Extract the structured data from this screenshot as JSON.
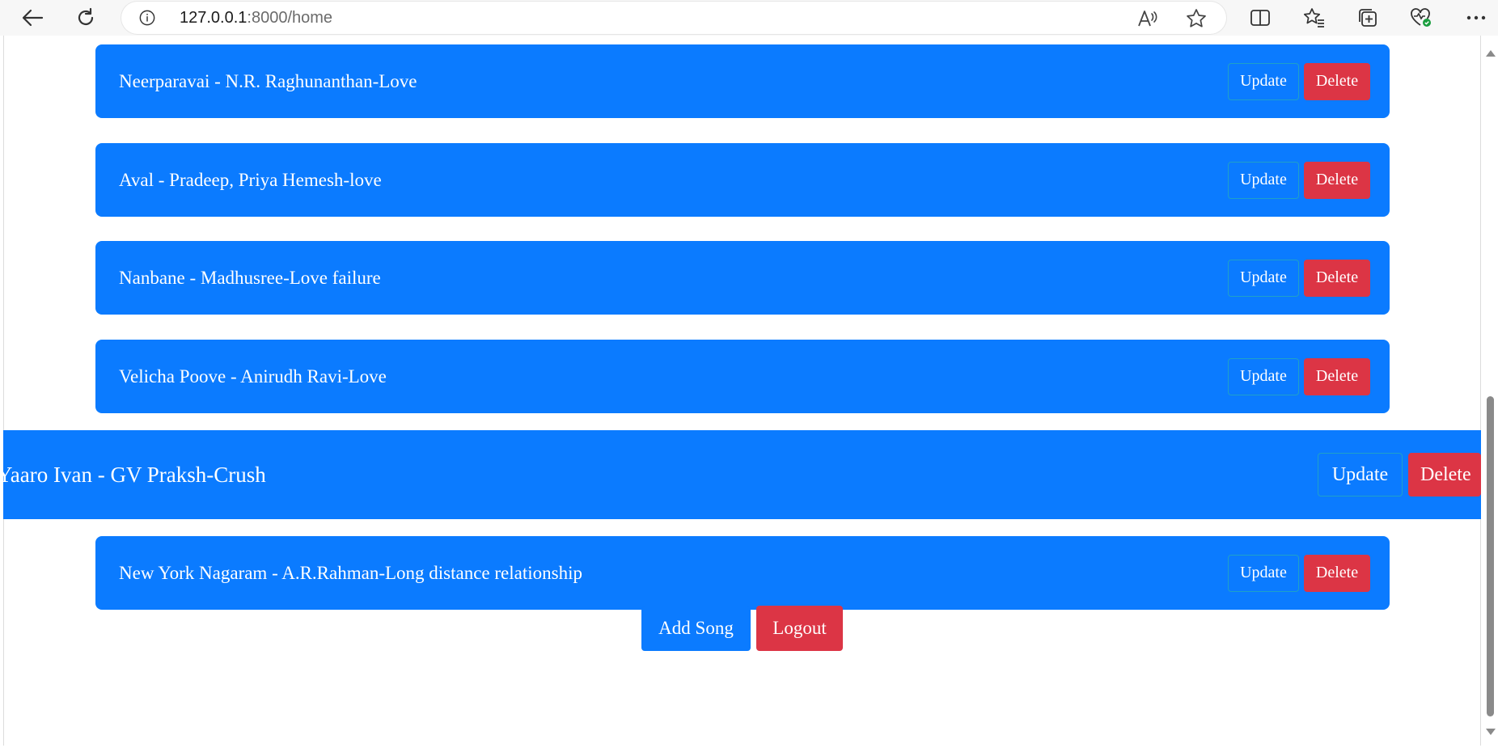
{
  "browser": {
    "url_host": "127.0.0.1",
    "url_path": ":8000/home",
    "icons": [
      "back-icon",
      "refresh-icon",
      "site-info-icon",
      "read-aloud-icon",
      "favorite-star-icon",
      "split-screen-icon",
      "favorites-icon",
      "collections-icon",
      "browser-essentials-icon",
      "more-icon"
    ]
  },
  "songs": [
    {
      "title": "Neerparavai - N.R. Raghunanthan-Love",
      "update_label": "Update",
      "delete_label": "Delete"
    },
    {
      "title": "Aval - Pradeep, Priya Hemesh-love",
      "update_label": "Update",
      "delete_label": "Delete"
    },
    {
      "title": "Nanbane - Madhusree-Love failure",
      "update_label": "Update",
      "delete_label": "Delete"
    },
    {
      "title": "Velicha Poove - Anirudh Ravi-Love",
      "update_label": "Update",
      "delete_label": "Delete"
    },
    {
      "title": "Yaaro Ivan - GV Praksh-Crush",
      "update_label": "Update",
      "delete_label": "Delete"
    },
    {
      "title": "New York Nagaram - A.R.Rahman-Long distance relationship",
      "update_label": "Update",
      "delete_label": "Delete"
    }
  ],
  "actions": {
    "add_label": "Add Song",
    "logout_label": "Logout"
  },
  "colors": {
    "card_blue": "#0b7bff",
    "delete_red": "#dc3545",
    "update_border": "#1fa1c8"
  }
}
